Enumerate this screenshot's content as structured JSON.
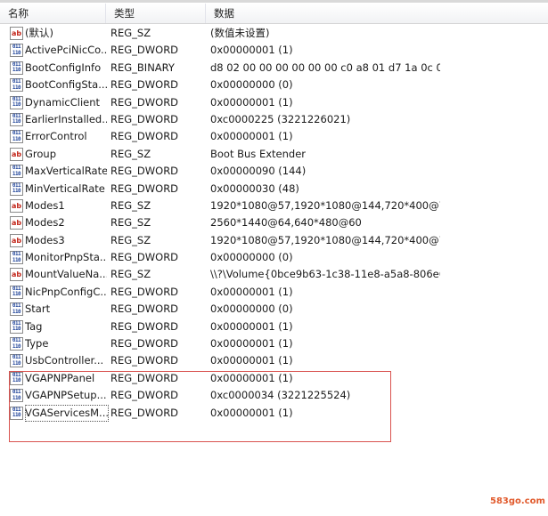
{
  "columns": {
    "name": "名称",
    "type": "类型",
    "data": "数据"
  },
  "rows": [
    {
      "icon": "sz",
      "name": "(默认)",
      "type": "REG_SZ",
      "data": "(数值未设置)"
    },
    {
      "icon": "bin",
      "name": "ActivePciNicCo...",
      "type": "REG_DWORD",
      "data": "0x00000001 (1)"
    },
    {
      "icon": "bin",
      "name": "BootConfigInfo",
      "type": "REG_BINARY",
      "data": "d8 02 00 00 00 00 00 00 c0 a8 01 d7 1a 0c 00..."
    },
    {
      "icon": "bin",
      "name": "BootConfigSta...",
      "type": "REG_DWORD",
      "data": "0x00000000 (0)"
    },
    {
      "icon": "bin",
      "name": "DynamicClient",
      "type": "REG_DWORD",
      "data": "0x00000001 (1)"
    },
    {
      "icon": "bin",
      "name": "EarlierInstalled...",
      "type": "REG_DWORD",
      "data": "0xc0000225 (3221226021)"
    },
    {
      "icon": "bin",
      "name": "ErrorControl",
      "type": "REG_DWORD",
      "data": "0x00000001 (1)"
    },
    {
      "icon": "sz",
      "name": "Group",
      "type": "REG_SZ",
      "data": "Boot Bus Extender"
    },
    {
      "icon": "bin",
      "name": "MaxVerticalRate",
      "type": "REG_DWORD",
      "data": "0x00000090 (144)"
    },
    {
      "icon": "bin",
      "name": "MinVerticalRate",
      "type": "REG_DWORD",
      "data": "0x00000030 (48)"
    },
    {
      "icon": "sz",
      "name": "Modes1",
      "type": "REG_SZ",
      "data": "1920*1080@57,1920*1080@144,720*400@70,..."
    },
    {
      "icon": "sz",
      "name": "Modes2",
      "type": "REG_SZ",
      "data": "2560*1440@64,640*480@60"
    },
    {
      "icon": "sz",
      "name": "Modes3",
      "type": "REG_SZ",
      "data": "1920*1080@57,1920*1080@144,720*400@70,..."
    },
    {
      "icon": "bin",
      "name": "MonitorPnpSta...",
      "type": "REG_DWORD",
      "data": "0x00000000 (0)"
    },
    {
      "icon": "sz",
      "name": "MountValueNa...",
      "type": "REG_SZ",
      "data": "\\\\?\\Volume{0bce9b63-1c38-11e8-a5a8-806e6..."
    },
    {
      "icon": "bin",
      "name": "NicPnpConfigC...",
      "type": "REG_DWORD",
      "data": "0x00000001 (1)"
    },
    {
      "icon": "bin",
      "name": "Start",
      "type": "REG_DWORD",
      "data": "0x00000000 (0)"
    },
    {
      "icon": "bin",
      "name": "Tag",
      "type": "REG_DWORD",
      "data": "0x00000001 (1)"
    },
    {
      "icon": "bin",
      "name": "Type",
      "type": "REG_DWORD",
      "data": "0x00000001 (1)"
    },
    {
      "icon": "bin",
      "name": "UsbController...",
      "type": "REG_DWORD",
      "data": "0x00000001 (1)"
    },
    {
      "icon": "bin",
      "name": "VGAPNPPanel",
      "type": "REG_DWORD",
      "data": "0x00000001 (1)"
    },
    {
      "icon": "bin",
      "name": "VGAPNPSetup...",
      "type": "REG_DWORD",
      "data": "0xc0000034 (3221225524)"
    },
    {
      "icon": "bin",
      "name": "VGAServicesM...",
      "type": "REG_DWORD",
      "data": "0x00000001 (1)",
      "selected": true
    }
  ],
  "icon_glyphs": {
    "sz": "ab",
    "bin": "011 110"
  },
  "watermark": "583go.com",
  "colors": {
    "highlight_box": "#d9534f",
    "sz_icon": "#c2261a",
    "bin_icon": "#24489c"
  }
}
